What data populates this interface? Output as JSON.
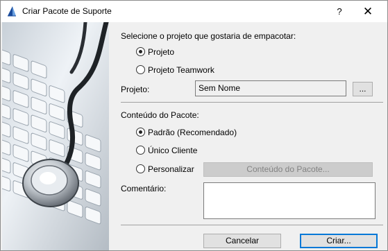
{
  "window": {
    "title": "Criar Pacote de Suporte",
    "help_label": "?",
    "close_label": "✕"
  },
  "project_section": {
    "prompt": "Selecione o projeto que gostaria de empacotar:",
    "options": [
      {
        "label": "Projeto",
        "selected": true
      },
      {
        "label": "Projeto Teamwork",
        "selected": false
      }
    ],
    "project_label": "Projeto:",
    "project_value": "Sem Nome",
    "browse_label": "..."
  },
  "content_section": {
    "heading": "Conteúdo do Pacote:",
    "options": [
      {
        "label": "Padrão (Recomendado)",
        "selected": true
      },
      {
        "label": "Único Cliente",
        "selected": false
      },
      {
        "label": "Personalizar",
        "selected": false
      }
    ],
    "content_button_label": "Conteúdo do Pacote..."
  },
  "comment": {
    "label": "Comentário:",
    "value": ""
  },
  "footer": {
    "cancel_label": "Cancelar",
    "create_label": "Criar..."
  },
  "colors": {
    "accent": "#0078d7",
    "dialog_bg": "#f0f0f0",
    "disabled_text": "#838383"
  }
}
